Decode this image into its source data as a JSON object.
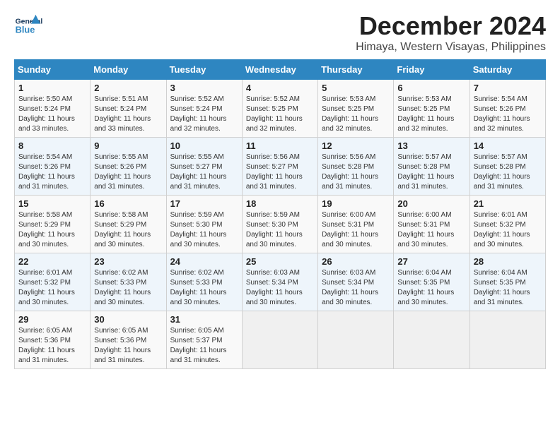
{
  "header": {
    "logo_general": "General",
    "logo_blue": "Blue",
    "month": "December 2024",
    "location": "Himaya, Western Visayas, Philippines"
  },
  "calendar": {
    "days_of_week": [
      "Sunday",
      "Monday",
      "Tuesday",
      "Wednesday",
      "Thursday",
      "Friday",
      "Saturday"
    ],
    "weeks": [
      [
        {
          "day": "",
          "info": ""
        },
        {
          "day": "2",
          "info": "Sunrise: 5:51 AM\nSunset: 5:24 PM\nDaylight: 11 hours\nand 33 minutes."
        },
        {
          "day": "3",
          "info": "Sunrise: 5:52 AM\nSunset: 5:24 PM\nDaylight: 11 hours\nand 32 minutes."
        },
        {
          "day": "4",
          "info": "Sunrise: 5:52 AM\nSunset: 5:25 PM\nDaylight: 11 hours\nand 32 minutes."
        },
        {
          "day": "5",
          "info": "Sunrise: 5:53 AM\nSunset: 5:25 PM\nDaylight: 11 hours\nand 32 minutes."
        },
        {
          "day": "6",
          "info": "Sunrise: 5:53 AM\nSunset: 5:25 PM\nDaylight: 11 hours\nand 32 minutes."
        },
        {
          "day": "7",
          "info": "Sunrise: 5:54 AM\nSunset: 5:26 PM\nDaylight: 11 hours\nand 32 minutes."
        }
      ],
      [
        {
          "day": "1",
          "info": "Sunrise: 5:50 AM\nSunset: 5:24 PM\nDaylight: 11 hours\nand 33 minutes.",
          "first": true
        },
        {
          "day": "8",
          "info": "Sunrise: 5:54 AM\nSunset: 5:26 PM\nDaylight: 11 hours\nand 31 minutes."
        },
        {
          "day": "9",
          "info": "Sunrise: 5:55 AM\nSunset: 5:26 PM\nDaylight: 11 hours\nand 31 minutes."
        },
        {
          "day": "10",
          "info": "Sunrise: 5:55 AM\nSunset: 5:27 PM\nDaylight: 11 hours\nand 31 minutes."
        },
        {
          "day": "11",
          "info": "Sunrise: 5:56 AM\nSunset: 5:27 PM\nDaylight: 11 hours\nand 31 minutes."
        },
        {
          "day": "12",
          "info": "Sunrise: 5:56 AM\nSunset: 5:28 PM\nDaylight: 11 hours\nand 31 minutes."
        },
        {
          "day": "13",
          "info": "Sunrise: 5:57 AM\nSunset: 5:28 PM\nDaylight: 11 hours\nand 31 minutes."
        },
        {
          "day": "14",
          "info": "Sunrise: 5:57 AM\nSunset: 5:28 PM\nDaylight: 11 hours\nand 31 minutes."
        }
      ],
      [
        {
          "day": "15",
          "info": "Sunrise: 5:58 AM\nSunset: 5:29 PM\nDaylight: 11 hours\nand 30 minutes."
        },
        {
          "day": "16",
          "info": "Sunrise: 5:58 AM\nSunset: 5:29 PM\nDaylight: 11 hours\nand 30 minutes."
        },
        {
          "day": "17",
          "info": "Sunrise: 5:59 AM\nSunset: 5:30 PM\nDaylight: 11 hours\nand 30 minutes."
        },
        {
          "day": "18",
          "info": "Sunrise: 5:59 AM\nSunset: 5:30 PM\nDaylight: 11 hours\nand 30 minutes."
        },
        {
          "day": "19",
          "info": "Sunrise: 6:00 AM\nSunset: 5:31 PM\nDaylight: 11 hours\nand 30 minutes."
        },
        {
          "day": "20",
          "info": "Sunrise: 6:00 AM\nSunset: 5:31 PM\nDaylight: 11 hours\nand 30 minutes."
        },
        {
          "day": "21",
          "info": "Sunrise: 6:01 AM\nSunset: 5:32 PM\nDaylight: 11 hours\nand 30 minutes."
        }
      ],
      [
        {
          "day": "22",
          "info": "Sunrise: 6:01 AM\nSunset: 5:32 PM\nDaylight: 11 hours\nand 30 minutes."
        },
        {
          "day": "23",
          "info": "Sunrise: 6:02 AM\nSunset: 5:33 PM\nDaylight: 11 hours\nand 30 minutes."
        },
        {
          "day": "24",
          "info": "Sunrise: 6:02 AM\nSunset: 5:33 PM\nDaylight: 11 hours\nand 30 minutes."
        },
        {
          "day": "25",
          "info": "Sunrise: 6:03 AM\nSunset: 5:34 PM\nDaylight: 11 hours\nand 30 minutes."
        },
        {
          "day": "26",
          "info": "Sunrise: 6:03 AM\nSunset: 5:34 PM\nDaylight: 11 hours\nand 30 minutes."
        },
        {
          "day": "27",
          "info": "Sunrise: 6:04 AM\nSunset: 5:35 PM\nDaylight: 11 hours\nand 30 minutes."
        },
        {
          "day": "28",
          "info": "Sunrise: 6:04 AM\nSunset: 5:35 PM\nDaylight: 11 hours\nand 31 minutes."
        }
      ],
      [
        {
          "day": "29",
          "info": "Sunrise: 6:05 AM\nSunset: 5:36 PM\nDaylight: 11 hours\nand 31 minutes."
        },
        {
          "day": "30",
          "info": "Sunrise: 6:05 AM\nSunset: 5:36 PM\nDaylight: 11 hours\nand 31 minutes."
        },
        {
          "day": "31",
          "info": "Sunrise: 6:05 AM\nSunset: 5:37 PM\nDaylight: 11 hours\nand 31 minutes."
        },
        {
          "day": "",
          "info": ""
        },
        {
          "day": "",
          "info": ""
        },
        {
          "day": "",
          "info": ""
        },
        {
          "day": "",
          "info": ""
        }
      ]
    ]
  }
}
